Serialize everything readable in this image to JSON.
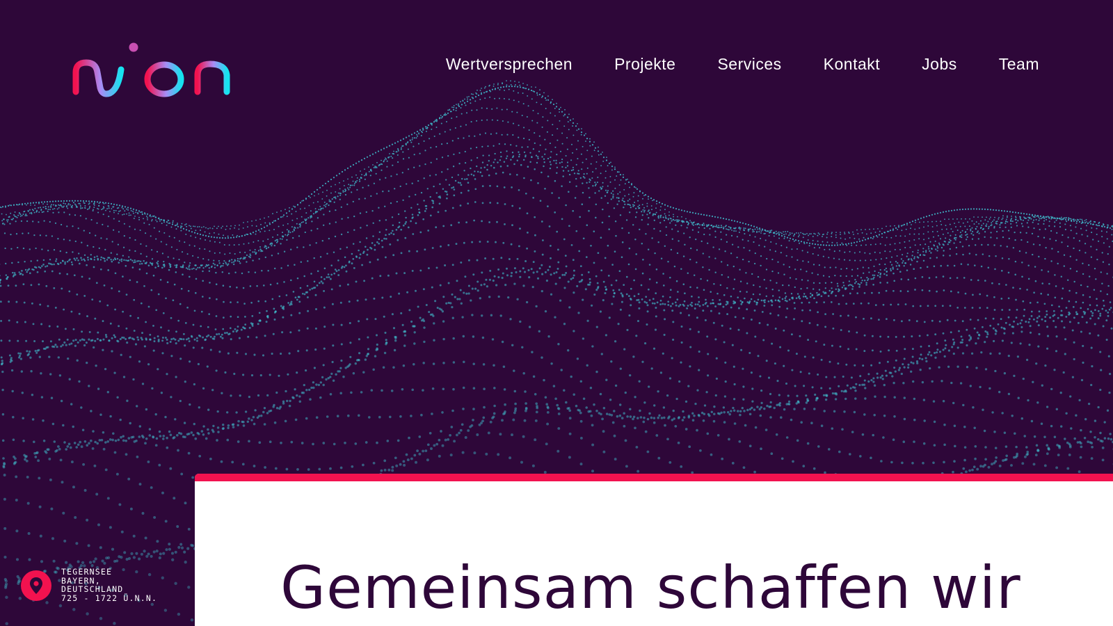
{
  "brand": {
    "logo_text": "nion",
    "colors": {
      "background": "#2e0739",
      "accent": "#f2124f",
      "dots": "#3fb5c6",
      "logo_gradient": [
        "#f2124f",
        "#a98bf5",
        "#16e3f0"
      ],
      "card": "#ffffff"
    }
  },
  "nav": {
    "items": [
      {
        "label": "Wertversprechen"
      },
      {
        "label": "Projekte"
      },
      {
        "label": "Services"
      },
      {
        "label": "Kontakt"
      },
      {
        "label": "Jobs"
      },
      {
        "label": "Team"
      }
    ]
  },
  "hero": {
    "headline": "Gemeinsam schaffen wir"
  },
  "location": {
    "icon": "map-pin-icon",
    "lines": [
      "Tegernsee",
      "Bayern,",
      "Deutschland",
      "725 - 1722 Ü.N.N."
    ]
  }
}
